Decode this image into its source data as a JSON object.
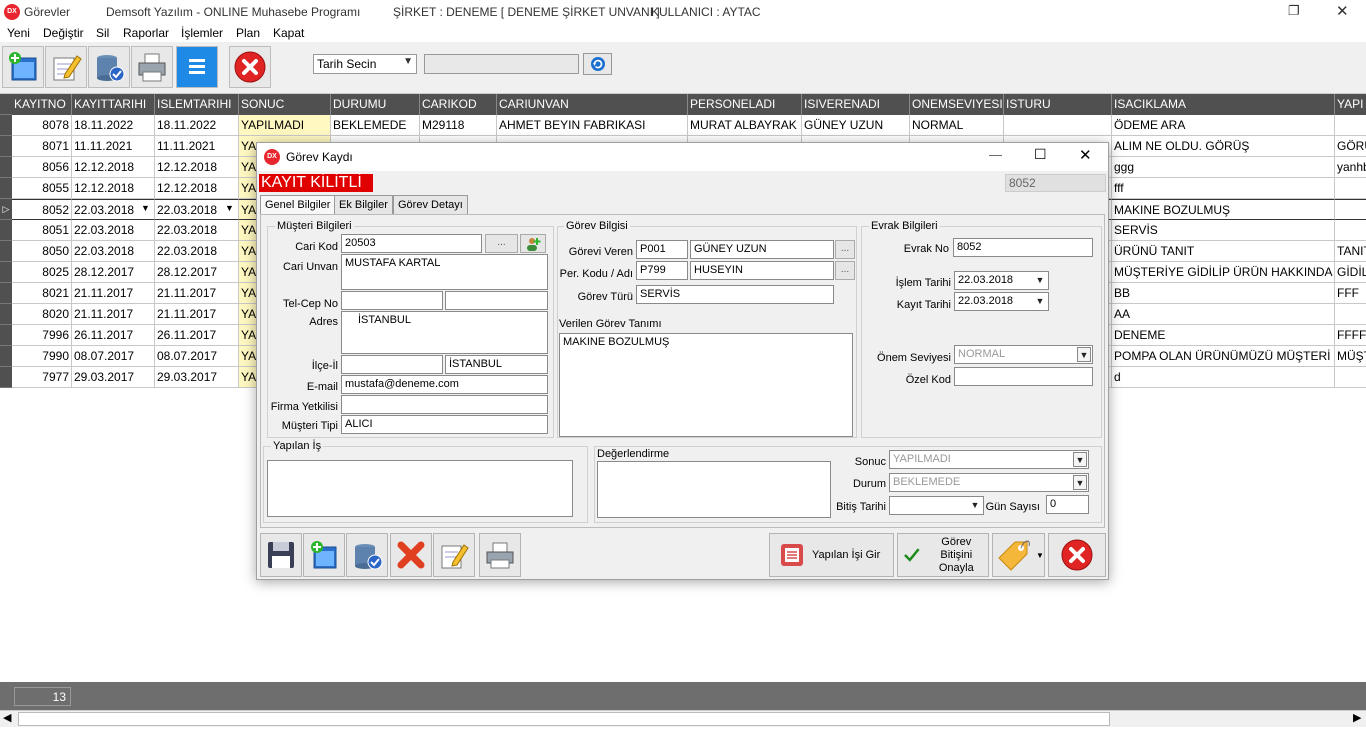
{
  "window": {
    "app_label": "Görevler",
    "program": "Demsoft Yazılım - ONLINE Muhasebe Programı",
    "company": "ŞİRKET : DENEME [ DENEME ŞİRKET UNVANI ]",
    "user": "KULLANICI : AYTAC",
    "logo_text": "DX"
  },
  "menu": [
    "Yeni",
    "Değiştir",
    "Sil",
    "Raporlar",
    "İşlemler",
    "Plan",
    "Kapat"
  ],
  "toolbar": {
    "buttons": [
      "new-icon",
      "edit-icon",
      "delete-icon",
      "print-icon",
      "list-icon",
      "close-icon"
    ],
    "date_select": "Tarih Secin",
    "date_value": ""
  },
  "grid": {
    "columns": [
      "KAYITNO",
      "KAYITTARIHI",
      "ISLEMTARIHI",
      "SONUC",
      "DURUMU",
      "CARIKOD",
      "CARIUNVAN",
      "PERSONELADI",
      "ISIVERENADI",
      "ONEMSEVIYESI",
      "ISTURU",
      "ISACIKLAMA",
      "YAPI"
    ],
    "rows": [
      [
        "8078",
        "18.11.2022",
        "18.11.2022",
        "YAPILMADI",
        "BEKLEMEDE",
        "M29118",
        "AHMET BEYIN FABRIKASI",
        "MURAT ALBAYRAK",
        "GÜNEY UZUN",
        "NORMAL",
        "",
        "ÖDEME ARA",
        ""
      ],
      [
        "8071",
        "11.11.2021",
        "11.11.2021",
        "YA",
        "",
        "",
        "",
        "",
        "",
        "",
        "",
        "ALIM NE OLDU. GÖRÜŞ",
        "GÖRÜ"
      ],
      [
        "8056",
        "12.12.2018",
        "12.12.2018",
        "YA",
        "",
        "",
        "",
        "",
        "",
        "",
        "",
        "ggg",
        "yanhb"
      ],
      [
        "8055",
        "12.12.2018",
        "12.12.2018",
        "YA",
        "",
        "",
        "",
        "",
        "",
        "",
        "",
        "fff",
        ""
      ],
      [
        "8052",
        "22.03.2018",
        "22.03.2018",
        "YA",
        "",
        "",
        "",
        "",
        "",
        "",
        "",
        "MAKINE BOZULMUŞ",
        ""
      ],
      [
        "8051",
        "22.03.2018",
        "22.03.2018",
        "YA",
        "",
        "",
        "",
        "",
        "",
        "",
        "",
        "SERVİS",
        ""
      ],
      [
        "8050",
        "22.03.2018",
        "22.03.2018",
        "YA",
        "",
        "",
        "",
        "",
        "",
        "",
        "",
        "ÜRÜNÜ TANIT",
        "TANIT"
      ],
      [
        "8025",
        "28.12.2017",
        "28.12.2017",
        "YA",
        "",
        "",
        "",
        "",
        "",
        "",
        "",
        "MÜŞTERİYE GİDİLİP ÜRÜN HAKKINDA TAN",
        "GİDİL"
      ],
      [
        "8021",
        "21.11.2017",
        "21.11.2017",
        "YA",
        "",
        "",
        "",
        "",
        "",
        "",
        "",
        "BB",
        "FFF"
      ],
      [
        "8020",
        "21.11.2017",
        "21.11.2017",
        "YA",
        "",
        "",
        "",
        "",
        "",
        "",
        "",
        "AA",
        ""
      ],
      [
        "7996",
        "26.11.2017",
        "26.11.2017",
        "YA",
        "",
        "",
        "",
        "",
        "",
        "",
        "",
        "DENEME",
        "FFFF"
      ],
      [
        "7990",
        "08.07.2017",
        "08.07.2017",
        "YA",
        "",
        "",
        "",
        "",
        "",
        "",
        "",
        "POMPA OLAN ÜRÜNÜMÜZÜ MÜŞTERİ YAN",
        "MÜŞT"
      ],
      [
        "7977",
        "29.03.2017",
        "29.03.2017",
        "YA",
        "",
        "",
        "",
        "",
        "",
        "",
        "",
        "d",
        ""
      ]
    ],
    "record_count": "13"
  },
  "dialog": {
    "title": "Görev Kaydı",
    "lock_label": "KAYIT KİLİTLİ",
    "record_id": "8052",
    "tabs": [
      "Genel Bilgiler",
      "Ek Bilgiler",
      "Görev Detayı"
    ],
    "customer": {
      "group": "Müşteri Bilgileri",
      "cari_kod_label": "Cari Kod",
      "cari_kod": "20503",
      "cari_unvan_label": "Cari Unvan",
      "cari_unvan": "MUSTAFA KARTAL",
      "tel_label": "Tel-Cep No",
      "tel": "",
      "cep": "",
      "adres_label": "Adres",
      "adres": "İSTANBUL",
      "ilce_label": "İlçe-İl",
      "ilce": "",
      "il": "İSTANBUL",
      "email_label": "E-mail",
      "email": "mustafa@deneme.com",
      "yetkili_label": "Firma Yetkilisi",
      "yetkili": "",
      "tip_label": "Müşteri Tipi",
      "tip": "ALICI"
    },
    "task": {
      "group": "Görev Bilgisi",
      "veren_label": "Görevi Veren",
      "veren_kod": "P001",
      "veren_ad": "GÜNEY UZUN",
      "per_label": "Per. Kodu / Adı",
      "per_kod": "P799",
      "per_ad": "HUSEYIN",
      "tur_label": "Görev Türü",
      "tur": "SERVİS",
      "tanim_label": "Verilen Görev Tanımı",
      "tanim": "MAKINE BOZULMUŞ"
    },
    "doc": {
      "group": "Evrak Bilgileri",
      "no_label": "Evrak No",
      "no": "8052",
      "islem_label": "İşlem Tarihi",
      "islem": "22.03.2018",
      "kayit_label": "Kayıt Tarihi",
      "kayit": "22.03.2018",
      "onem_label": "Önem Seviyesi",
      "onem": "NORMAL",
      "ozel_label": "Özel Kod",
      "ozel": ""
    },
    "work": {
      "group": "Yapılan İş",
      "text": ""
    },
    "eval": {
      "group": "Değerlendirme",
      "text": "",
      "sonuc_label": "Sonuc",
      "sonuc": "YAPILMADI",
      "durum_label": "Durum",
      "durum": "BEKLEMEDE",
      "bitis_label": "Bitiş Tarihi",
      "bitis": "",
      "gun_label": "Gün Sayısı",
      "gun": "0"
    },
    "buttons": {
      "yapilan": "Yapılan İşi Gir",
      "onayla_1": "Görev Bitişini",
      "onayla_2": "Onayla"
    }
  }
}
